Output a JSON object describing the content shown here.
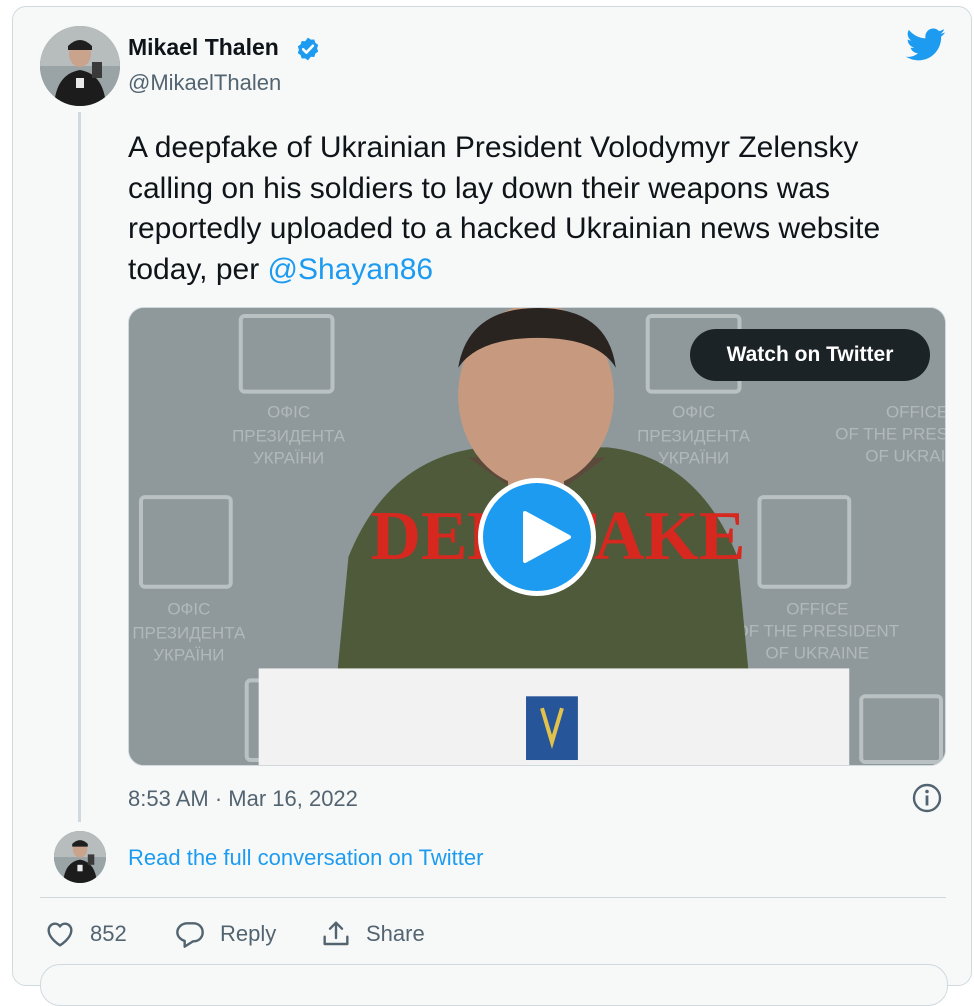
{
  "author": {
    "name": "Mikael Thalen",
    "handle": "@MikaelThalen",
    "verified": true,
    "avatar_icon": "avatar-photo-icon"
  },
  "tweet": {
    "text": "A deepfake of Ukrainian President Volodymyr Zelensky calling on his soldiers to lay down their weapons was reportedly uploaded to a hacked Ukrainian news website today, per ",
    "mention": "@Shayan86"
  },
  "media": {
    "watch_label": "Watch on Twitter",
    "overlay_text": "DEEPFAKE",
    "backdrop_text_1": "ОФІС",
    "backdrop_text_2": "ПРЕЗИДЕНТА",
    "backdrop_text_3": "УКРАЇНИ",
    "backdrop_text_4": "OFFICE",
    "backdrop_text_5": "OF THE PRESIDENT",
    "backdrop_text_6": "OF UKRAINE",
    "play_icon": "play-icon"
  },
  "meta": {
    "timestamp": "8:53 AM · Mar 16, 2022"
  },
  "conversation": {
    "link_text": "Read the full conversation on Twitter"
  },
  "actions": {
    "like_count": "852",
    "reply_label": "Reply",
    "share_label": "Share"
  },
  "colors": {
    "accent": "#1d9bf0",
    "text": "#0f1419",
    "muted": "#536471",
    "deepfake_red": "#d6281f"
  }
}
